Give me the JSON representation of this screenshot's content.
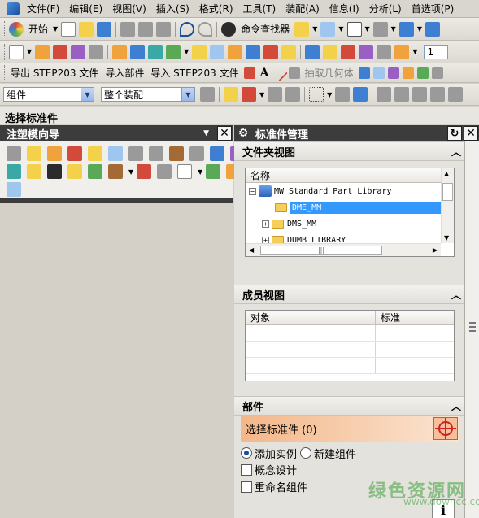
{
  "menubar": {
    "items": [
      "文件(F)",
      "编辑(E)",
      "视图(V)",
      "插入(S)",
      "格式(R)",
      "工具(T)",
      "装配(A)",
      "信息(I)",
      "分析(L)",
      "首选项(P)"
    ]
  },
  "toolbar1": {
    "start_label": "开始",
    "command_finder_label": "命令查找器",
    "right_combo_value": "1"
  },
  "toolbar3": {
    "export_label": "导出 STEP203 文件",
    "import_part_label": "导入部件",
    "import_step_label": "导入 STEP203 文件",
    "extract_geometry_label": "抽取几何体"
  },
  "toolbar4": {
    "filter_combo": "组件",
    "scope_combo": "整个装配"
  },
  "status": {
    "prompt": "选择标准件"
  },
  "left_panel": {
    "title": "注塑模向导"
  },
  "right_panel": {
    "title": "标准件管理",
    "folder_view": {
      "header": "文件夹视图",
      "column": "名称",
      "rows": [
        {
          "label": "MW Standard Part Library",
          "type": "library",
          "expand": "−"
        },
        {
          "label": "DME_MM",
          "type": "folder",
          "expand": "",
          "selected": true
        },
        {
          "label": "DMS_MM",
          "type": "folder",
          "expand": "+"
        },
        {
          "label": "DUMB LIBRARY",
          "type": "folder",
          "expand": "+"
        }
      ]
    },
    "member_view": {
      "header": "成员视图",
      "columns": [
        "对象",
        "标准"
      ]
    },
    "parts": {
      "header": "部件",
      "select_label": "选择标准件 (0)",
      "radio_add_instance": "添加实例",
      "radio_new_component": "新建组件",
      "check_concept_design": "概念设计",
      "check_rename_component": "重命名组件"
    }
  },
  "watermark": {
    "brand": "绿色资源网",
    "url": "www.downcc.com"
  }
}
